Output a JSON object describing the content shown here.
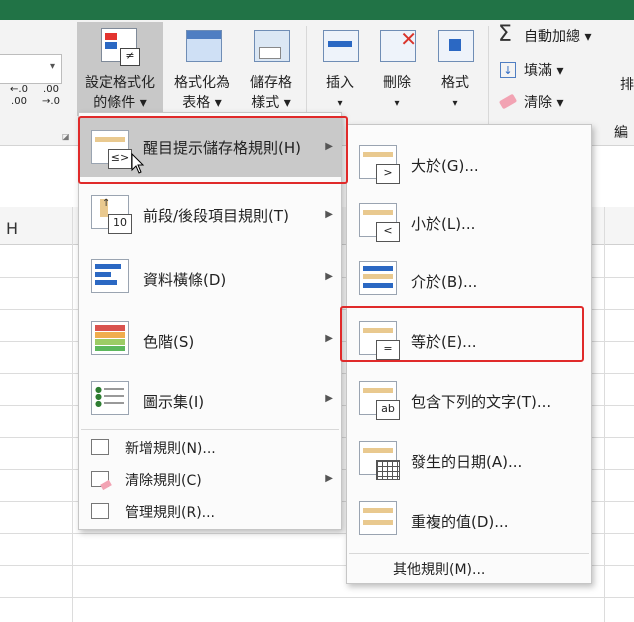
{
  "ribbon": {
    "left_group": {
      "dec_increase": "←.0\n.00",
      "dec_decrease": ".00\n→.0"
    },
    "conditional_format": {
      "line1": "設定格式化",
      "line2": "的條件 ▾"
    },
    "format_as_table": {
      "line1": "格式化為",
      "line2": "表格 ▾"
    },
    "cell_styles": {
      "line1": "儲存格",
      "line2": "樣式 ▾"
    },
    "insert": {
      "label": "插入",
      "caret": "▾"
    },
    "delete": {
      "label": "刪除",
      "caret": "▾"
    },
    "format": {
      "label": "格式",
      "caret": "▾"
    },
    "autosum": {
      "label": "自動加總 ▾"
    },
    "fill": {
      "label": "填滿 ▾"
    },
    "clear": {
      "label": "清除 ▾"
    },
    "right_cut1": "排",
    "right_cut2": "編"
  },
  "sheet": {
    "column_h": "H"
  },
  "main_menu": {
    "items": [
      {
        "label": "醒目提示儲存格規則(H)",
        "icon": "highlight-rules-icon",
        "sub": "≤>",
        "arrow": "▶"
      },
      {
        "label": "前段/後段項目規則(T)",
        "icon": "top-bottom-rules-icon",
        "sub": "10",
        "arrow": "▶"
      },
      {
        "label": "資料橫條(D)",
        "icon": "data-bars-icon",
        "arrow": "▶"
      },
      {
        "label": "色階(S)",
        "icon": "color-scales-icon",
        "arrow": "▶"
      },
      {
        "label": "圖示集(I)",
        "icon": "icon-sets-icon",
        "arrow": "▶"
      }
    ],
    "small_items": [
      {
        "label": "新增規則(N)...",
        "icon": "new-rule-icon"
      },
      {
        "label": "清除規則(C)",
        "icon": "clear-rules-icon",
        "arrow": "▶"
      },
      {
        "label": "管理規則(R)...",
        "icon": "manage-rules-icon"
      }
    ]
  },
  "sub_menu": {
    "items": [
      {
        "label": "大於(G)...",
        "sub": ">"
      },
      {
        "label": "小於(L)...",
        "sub": "<"
      },
      {
        "label": "介於(B)...",
        "sub": ""
      },
      {
        "label": "等於(E)...",
        "sub": "="
      },
      {
        "label": "包含下列的文字(T)...",
        "sub": "ab"
      },
      {
        "label": "發生的日期(A)...",
        "sub": ""
      },
      {
        "label": "重複的值(D)...",
        "sub": ""
      }
    ],
    "more": "其他規則(M)..."
  },
  "colors": {
    "accent_green": "#217346",
    "highlight": "#c8c8c8",
    "annotation_red": "#e02a2a"
  }
}
